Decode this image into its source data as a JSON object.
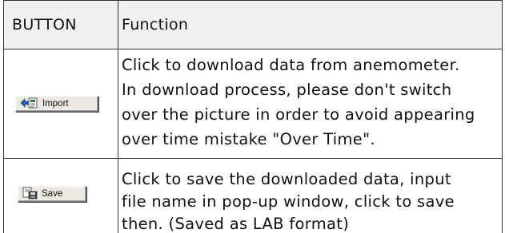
{
  "table": {
    "header": {
      "button": "BUTTON",
      "function": "Function"
    },
    "rows": [
      {
        "button_label": "Import",
        "button_icon": "import-icon",
        "function_lines": [
          "Click to download data from anemometer.",
          "In download process, please don't switch",
          "over the picture in order to avoid appearing",
          "over time mistake \"Over Time\"."
        ]
      },
      {
        "button_label": "Save",
        "button_icon": "save-icon",
        "function_lines": [
          "Click to save the downloaded data, input",
          "file name in pop-up window, click to save",
          "then. (Saved as LAB format)"
        ]
      }
    ]
  }
}
